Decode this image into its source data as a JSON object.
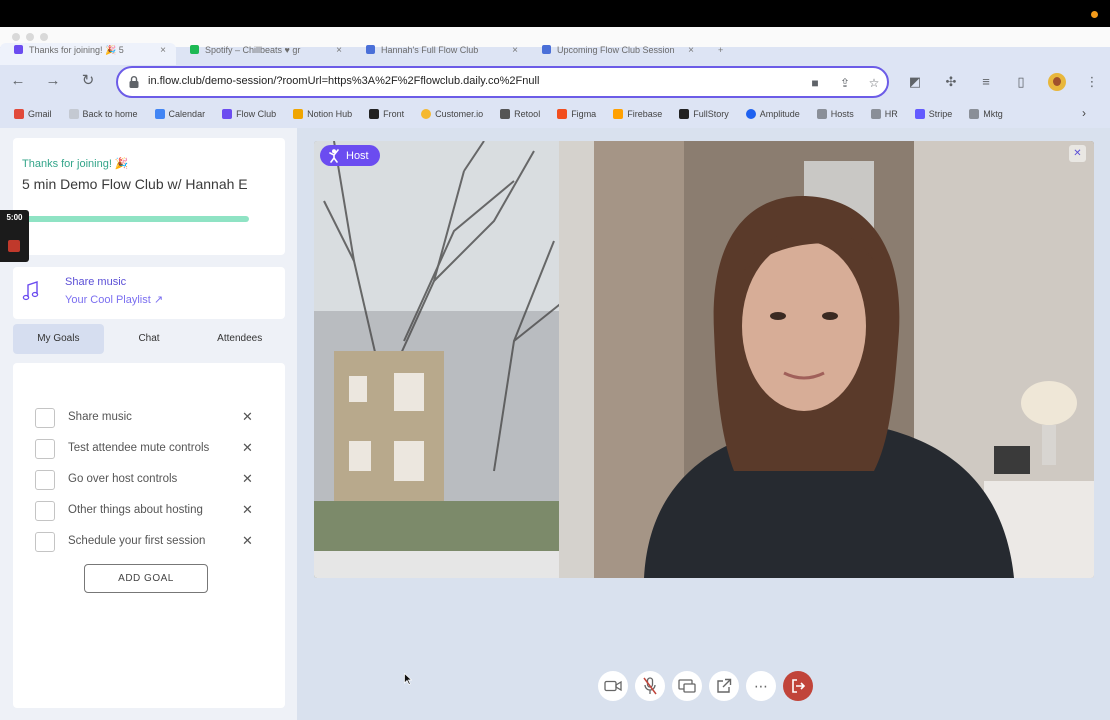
{
  "browser": {
    "tabs": [
      {
        "title": "Thanks for joining! 🎉 5",
        "active": true
      },
      {
        "title": "Spotify – Chillbeats ♥ gr",
        "active": false
      },
      {
        "title": "Hannah's Full Flow Club",
        "active": false
      },
      {
        "title": "Upcoming Flow Club Session",
        "active": false
      }
    ],
    "url": "in.flow.club/demo-session/?roomUrl=https%3A%2F%2Fflowclub.daily.co%2Fnull",
    "bookmarks": [
      {
        "label": "Gmail",
        "color": "#e14a3b"
      },
      {
        "label": "Back to home",
        "color": "#9aa0a6"
      },
      {
        "label": "Calendar",
        "color": "#4285f4"
      },
      {
        "label": "Flow Club",
        "color": "#6b4cf0"
      },
      {
        "label": "Notion Hub",
        "color": "#f0a500"
      },
      {
        "label": "Front",
        "color": "#222222"
      },
      {
        "label": "Customer.io",
        "color": "#f5b82e"
      },
      {
        "label": "Retool",
        "color": "#555555"
      },
      {
        "label": "Figma",
        "color": "#f24e1e"
      },
      {
        "label": "Firebase",
        "color": "#ffa000"
      },
      {
        "label": "FullStory",
        "color": "#222222"
      },
      {
        "label": "Amplitude",
        "color": "#1e61f0"
      },
      {
        "label": "Hosts",
        "color": "#8a8f98"
      },
      {
        "label": "HR",
        "color": "#8a8f98"
      },
      {
        "label": "Stripe",
        "color": "#635bff"
      },
      {
        "label": "Mktg",
        "color": "#8a8f98"
      }
    ]
  },
  "session": {
    "thanks": "Thanks for joining! 🎉",
    "title": "5 min Demo Flow Club w/ Hannah E",
    "progress": 1.0
  },
  "timer": {
    "label": "5:00"
  },
  "music": {
    "title": "Share music",
    "playlist": "Your Cool Playlist ↗"
  },
  "subtabs": [
    {
      "label": "My Goals",
      "active": true
    },
    {
      "label": "Chat",
      "active": false
    },
    {
      "label": "Attendees",
      "active": false
    }
  ],
  "goals": [
    {
      "text": "Share music",
      "checked": false
    },
    {
      "text": "Test attendee mute controls",
      "checked": false
    },
    {
      "text": "Go over host controls",
      "checked": false
    },
    {
      "text": "Other things about hosting",
      "checked": false
    },
    {
      "text": "Schedule your first session",
      "checked": false
    }
  ],
  "add_goal_label": "ADD GOAL",
  "video": {
    "host_label": "Host"
  },
  "colors": {
    "accent": "#6b4cf0",
    "leave": "#c1443a",
    "progress": "#8fe3c4",
    "thanks": "#34a58a"
  }
}
